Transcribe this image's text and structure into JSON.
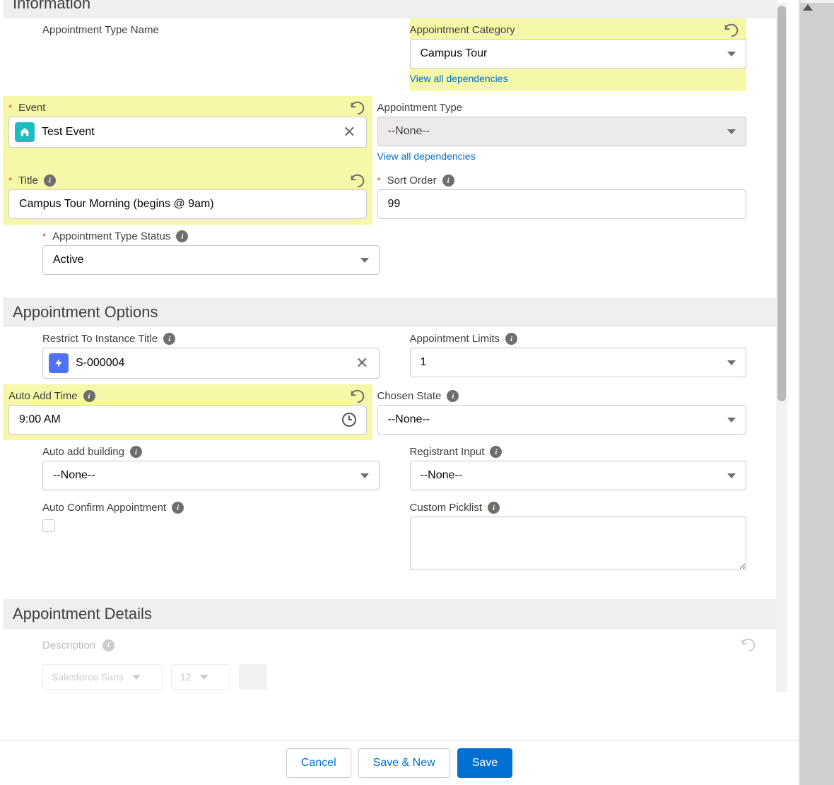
{
  "sections": {
    "information": "Information",
    "options": "Appointment Options",
    "details": "Appointment Details"
  },
  "labels": {
    "apptTypeName": "Appointment Type Name",
    "apptCategory": "Appointment Category",
    "event": "Event",
    "apptType": "Appointment Type",
    "title": "Title",
    "sortOrder": "Sort Order",
    "apptTypeStatus": "Appointment Type Status",
    "restrictInstance": "Restrict To Instance Title",
    "apptLimits": "Appointment Limits",
    "autoAddTime": "Auto Add Time",
    "chosenState": "Chosen State",
    "autoAddBuilding": "Auto add building",
    "registrantInput": "Registrant Input",
    "autoConfirm": "Auto Confirm Appointment",
    "customPicklist": "Custom Picklist",
    "description": "Description"
  },
  "values": {
    "apptCategory": "Campus Tour",
    "event": "Test Event",
    "apptType": "--None--",
    "title": "Campus Tour Morning (begins @ 9am)",
    "sortOrder": "99",
    "apptTypeStatus": "Active",
    "restrictInstance": "S-000004",
    "apptLimits": "1",
    "autoAddTime": "9:00 AM",
    "chosenState": "--None--",
    "autoAddBuilding": "--None--",
    "registrantInput": "--None--"
  },
  "links": {
    "viewDeps": "View all dependencies"
  },
  "buttons": {
    "cancel": "Cancel",
    "saveNew": "Save & New",
    "save": "Save"
  },
  "ghost": {
    "font": "Salesforce Sans",
    "size": "12"
  }
}
